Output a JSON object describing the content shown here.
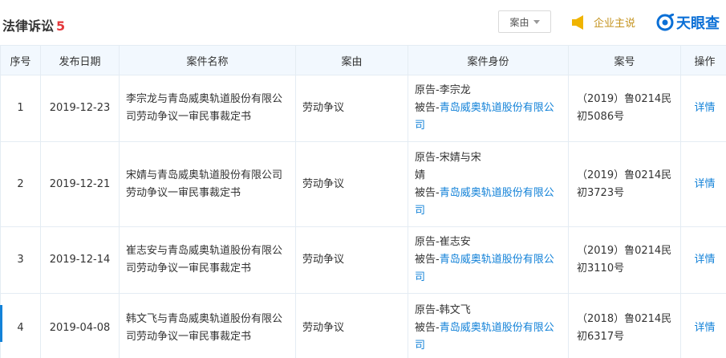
{
  "header": {
    "title": "法律诉讼",
    "count": "5",
    "filter_label": "案由",
    "speak_label": "企业主说",
    "brand_label": "天眼查"
  },
  "table": {
    "columns": [
      "序号",
      "发布日期",
      "案件名称",
      "案由",
      "案件身份",
      "案号",
      "操作"
    ],
    "rows": [
      {
        "index": "1",
        "date": "2019-12-23",
        "name": "李宗龙与青岛威奥轨道股份有限公司劳动争议一审民事裁定书",
        "reason": "劳动争议",
        "plaintiff": "原告-李宗龙",
        "defendant_prefix": "被告-",
        "defendant": "青岛威奥轨道股份有限公司",
        "case_no": "（2019）鲁0214民初5086号",
        "action": "详情"
      },
      {
        "index": "2",
        "date": "2019-12-21",
        "name": "宋婧与青岛威奥轨道股份有限公司劳动争议一审民事裁定书",
        "reason": "劳动争议",
        "plaintiff": "原告-宋婧与宋婧",
        "defendant_prefix": "被告-",
        "defendant": "青岛威奥轨道股份有限公司",
        "case_no": "（2019）鲁0214民初3723号",
        "action": "详情"
      },
      {
        "index": "3",
        "date": "2019-12-14",
        "name": "崔志安与青岛威奥轨道股份有限公司劳动争议一审民事裁定书",
        "reason": "劳动争议",
        "plaintiff": "原告-崔志安",
        "defendant_prefix": "被告-",
        "defendant": "青岛威奥轨道股份有限公司",
        "case_no": "（2019）鲁0214民初3110号",
        "action": "详情"
      },
      {
        "index": "4",
        "date": "2019-04-08",
        "name": "韩文飞与青岛威奥轨道股份有限公司劳动争议一审民事裁定书",
        "reason": "劳动争议",
        "plaintiff": "原告-韩文飞",
        "defendant_prefix": "被告-",
        "defendant": "青岛威奥轨道股份有限公司",
        "case_no": "（2018）鲁0214民初6317号",
        "action": "详情"
      }
    ]
  },
  "colors": {
    "link": "#1382d8",
    "count": "#e4393c",
    "header_bg": "#f2f8fe",
    "speak": "#c4931e",
    "brand": "#0a6fd6"
  },
  "icons": {
    "filter": "chevron-down-icon",
    "speak": "megaphone-icon",
    "brand": "tianyancha-logo-icon"
  }
}
